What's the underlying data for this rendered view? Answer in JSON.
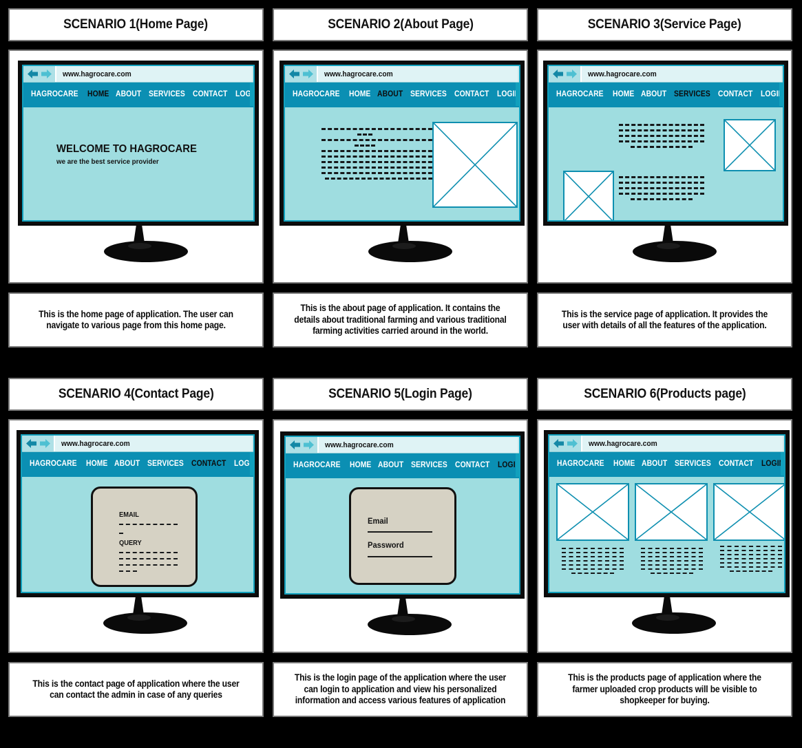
{
  "meta": {
    "background_color": "#000000",
    "panel_border_color": "#7a7a7a",
    "accent_teal": "#0b8fb3",
    "screen_teal": "#9fdde0",
    "placeholder_border": "#0e8fb0",
    "form_card_color": "#d6d2c4"
  },
  "browser": {
    "url": "www.hagrocare.com",
    "back_icon": "back-arrow-icon",
    "forward_icon": "forward-arrow-icon",
    "nav_items": [
      "HAGROCARE",
      "HOME",
      "ABOUT",
      "SERVICES",
      "CONTACT",
      "LOGIN"
    ]
  },
  "scenarios": [
    {
      "id": "scenario-1",
      "title": "SCENARIO 1(Home Page)",
      "active_nav": "HOME",
      "hero": {
        "title": "WELCOME TO HAGROCARE",
        "subtitle": "we are the best service provider"
      },
      "caption": "This is the home page of application. The user can navigate to various page from this home page."
    },
    {
      "id": "scenario-2",
      "title": "SCENARIO 2(About Page)",
      "active_nav": "ABOUT",
      "caption": "This is the about page of application. It contains the details about traditional farming and various traditional farming activities carried around in the world."
    },
    {
      "id": "scenario-3",
      "title": "SCENARIO 3(Service Page)",
      "active_nav": "SERVICES",
      "caption": "This is the service page of application. It provides the user with details of all the features of the application."
    },
    {
      "id": "scenario-4",
      "title": "SCENARIO 4(Contact Page)",
      "active_nav": "CONTACT",
      "form": {
        "field_1_label": "EMAIL",
        "field_2_label": "QUERY"
      },
      "caption": "This is the contact page of application where the user can contact the admin in case of any queries"
    },
    {
      "id": "scenario-5",
      "title": "SCENARIO 5(Login Page)",
      "active_nav": "LOGIN",
      "form": {
        "field_1_label": "Email",
        "field_2_label": "Password"
      },
      "caption": "This is the login page of the application where the user can login to application and view his personalized information and access various features of application"
    },
    {
      "id": "scenario-6",
      "title": "SCENARIO 6(Products page)",
      "active_nav": "LOGIN",
      "caption": "This is the products page of application where the farmer uploaded crop products will be visible to shopkeeper for buying."
    }
  ]
}
